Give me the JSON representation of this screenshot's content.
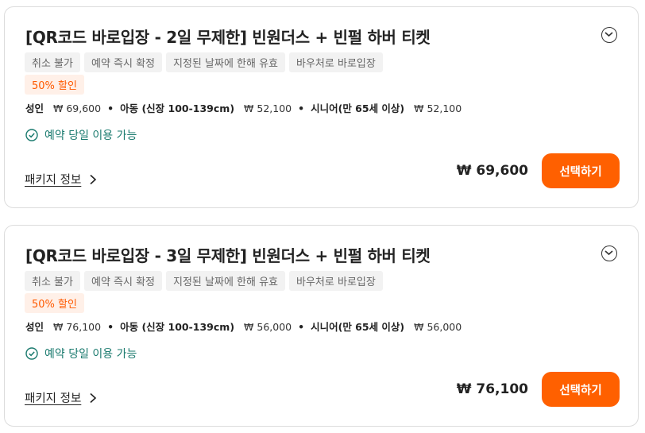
{
  "products": [
    {
      "title": "[QR코드 바로입장 - 2일 무제한] 빈원더스 + 빈펄 하버 티켓",
      "tags": [
        "취소 불가",
        "예약 즉시 확정",
        "지정된 날짜에 한해 유효",
        "바우처로 바로입장"
      ],
      "discount": "50% 할인",
      "prices": [
        {
          "label": "성인",
          "value": "₩ 69,600"
        },
        {
          "label": "아동 (신장 100-139cm)",
          "value": "₩ 52,100"
        },
        {
          "label": "시니어(만 65세 이상)",
          "value": "₩ 52,100"
        }
      ],
      "same_day": "예약 당일 이용 가능",
      "package_info": "패키지 정보",
      "total": "₩ 69,600",
      "select_label": "선택하기"
    },
    {
      "title": "[QR코드 바로입장 - 3일 무제한] 빈원더스 + 빈펄 하버 티켓",
      "tags": [
        "취소 불가",
        "예약 즉시 확정",
        "지정된 날짜에 한해 유효",
        "바우처로 바로입장"
      ],
      "discount": "50% 할인",
      "prices": [
        {
          "label": "성인",
          "value": "₩ 76,100"
        },
        {
          "label": "아동 (신장 100-139cm)",
          "value": "₩ 56,000"
        },
        {
          "label": "시니어(만 65세 이상)",
          "value": "₩ 56,000"
        }
      ],
      "same_day": "예약 당일 이용 가능",
      "package_info": "패키지 정보",
      "total": "₩ 76,100",
      "select_label": "선택하기"
    }
  ],
  "icons": {
    "expand": "chevron-down-circle-icon",
    "check": "check-circle-icon",
    "arrow": "chevron-right-icon"
  },
  "colors": {
    "accent": "#ff6000",
    "discount_text": "#ff5a00",
    "discount_bg": "#fff0e8",
    "same_day": "#1a7a6e"
  }
}
